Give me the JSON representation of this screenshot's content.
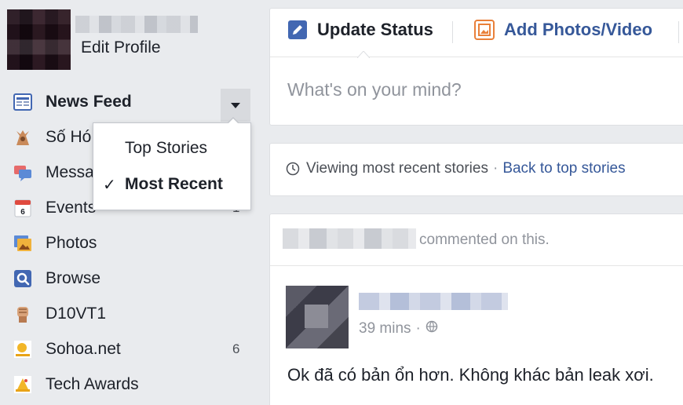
{
  "sidebar": {
    "profile": {
      "edit_label": "Edit Profile"
    },
    "items": [
      {
        "label": "News Feed",
        "icon": "news-feed-icon",
        "count": ""
      },
      {
        "label": "Số Hó",
        "icon": "group-icon",
        "count": ""
      },
      {
        "label": "Messa",
        "icon": "messages-icon",
        "count": ""
      },
      {
        "label": "Events",
        "icon": "calendar-icon",
        "count": "1",
        "icon_text": "6"
      },
      {
        "label": "Photos",
        "icon": "photos-icon",
        "count": ""
      },
      {
        "label": "Browse",
        "icon": "search-icon",
        "count": ""
      },
      {
        "label": "D10VT1",
        "icon": "fist-icon",
        "count": ""
      },
      {
        "label": "Sohoa.net",
        "icon": "page-icon",
        "count": "6"
      },
      {
        "label": "Tech Awards",
        "icon": "award-icon",
        "count": ""
      }
    ]
  },
  "feed_sort_menu": {
    "options": [
      {
        "label": "Top Stories",
        "selected": false
      },
      {
        "label": "Most Recent",
        "selected": true
      }
    ],
    "check": "✓"
  },
  "composer": {
    "tabs": [
      {
        "label": "Update Status",
        "icon": "pencil-icon"
      },
      {
        "label": "Add Photos/Video",
        "icon": "photo-icon"
      }
    ],
    "placeholder": "What's on your mind?"
  },
  "sort_notice": {
    "text": "Viewing most recent stories",
    "separator": "·",
    "link": "Back to top stories"
  },
  "post": {
    "activity": "commented on this.",
    "time": "39 mins",
    "separator": "·",
    "privacy_icon": "globe-icon",
    "text": "Ok đã có bản ổn hơn. Không khác bản leak xơi."
  },
  "colors": {
    "background": "#e9ebee",
    "link": "#365899",
    "text": "#1d2129",
    "muted": "#90949c"
  }
}
